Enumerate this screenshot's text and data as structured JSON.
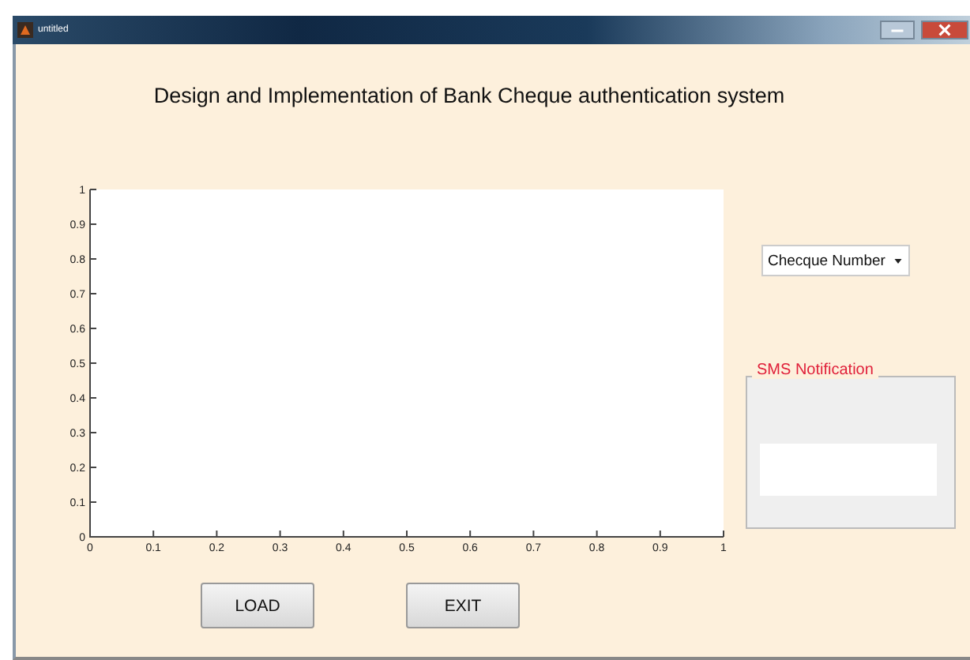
{
  "window": {
    "title": "untitled"
  },
  "heading": "Design and Implementation of Bank Cheque authentication system",
  "axes": {
    "chart_data": {
      "type": "line",
      "xlim": [
        0,
        1
      ],
      "ylim": [
        0,
        1
      ],
      "xticks": [
        0,
        0.1,
        0.2,
        0.3,
        0.4,
        0.5,
        0.6,
        0.7,
        0.8,
        0.9,
        1
      ],
      "yticks": [
        0,
        0.1,
        0.2,
        0.3,
        0.4,
        0.5,
        0.6,
        0.7,
        0.8,
        0.9,
        1
      ]
    }
  },
  "dropdown": {
    "value": "Checque Number"
  },
  "sms_panel": {
    "title": "SMS Notification"
  },
  "buttons": [
    "LOAD",
    "EXIT"
  ]
}
